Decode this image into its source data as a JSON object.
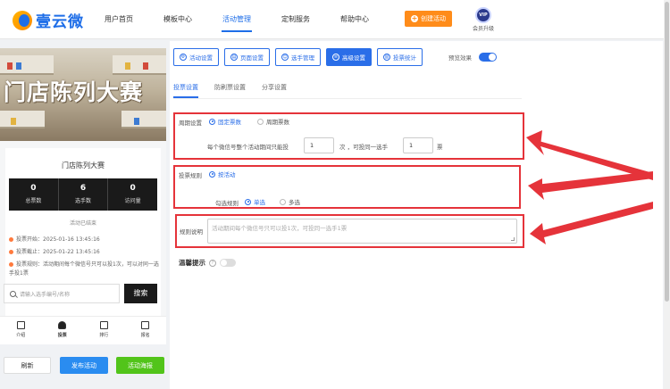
{
  "brand": {
    "name": "壹云微"
  },
  "nav": [
    {
      "label": "用户首页",
      "active": false
    },
    {
      "label": "模板中心",
      "active": false
    },
    {
      "label": "活动管理",
      "active": true
    },
    {
      "label": "定制服务",
      "active": false
    },
    {
      "label": "帮助中心",
      "active": false
    }
  ],
  "header": {
    "create_label": "创建活动",
    "vip_badge": "VIP",
    "vip_label": "会员升级"
  },
  "preview": {
    "banner_title": "门店陈列大赛",
    "contest_title": "门店陈列大赛",
    "stats": [
      {
        "value": "0",
        "label": "总票数"
      },
      {
        "value": "6",
        "label": "选手数"
      },
      {
        "value": "0",
        "label": "访问量"
      }
    ],
    "ended": "活动已结束",
    "start": "投票开始：2025-01-16 13:45:16",
    "end": "投票截止：2025-01-22 13:45:16",
    "rule": "投票规则：活动期间每个微信号只可以投1次，可以对同一选手投1票",
    "search_placeholder": "请输入选手编号/名称",
    "search_button": "搜索",
    "tabs": [
      {
        "label": "介绍",
        "active": false
      },
      {
        "label": "投票",
        "active": true
      },
      {
        "label": "排行",
        "active": false
      },
      {
        "label": "报名",
        "active": false
      }
    ]
  },
  "left_buttons": {
    "refresh": "刷新",
    "publish": "发布活动",
    "poster": "活动海报"
  },
  "toolbar": [
    {
      "label": "活动设置",
      "active": false
    },
    {
      "label": "页面设置",
      "active": false
    },
    {
      "label": "选手管理",
      "active": false
    },
    {
      "label": "高级设置",
      "active": true
    },
    {
      "label": "投票统计",
      "active": false
    }
  ],
  "preview_toggle": {
    "label": "预览效果",
    "on": true
  },
  "subtabs": [
    {
      "label": "投票设置",
      "active": true
    },
    {
      "label": "防刷票设置",
      "active": false
    },
    {
      "label": "分享设置",
      "active": false
    }
  ],
  "cycle": {
    "label": "周期设置",
    "options": [
      {
        "label": "固定票数",
        "checked": true
      },
      {
        "label": "周期票数",
        "checked": false
      }
    ],
    "prefix": "每个微信号整个活动期间只能投",
    "count": "1",
    "mid": "次 ，可投同一选手",
    "per_player": "1",
    "suffix": "票"
  },
  "vote_rule": {
    "label": "投票规则",
    "option": "按活动",
    "sub_label": "勾选规则",
    "choices": [
      {
        "label": "单选",
        "checked": true
      },
      {
        "label": "多选",
        "checked": false
      }
    ]
  },
  "rule_desc": {
    "label": "规则说明",
    "placeholder": "活动期间每个微信号只可以投1次，可投同一选手1票"
  },
  "tip": {
    "label": "温馨提示",
    "on": false
  },
  "colors": {
    "accent": "#2a6ee8",
    "highlight": "#e5333a",
    "create": "#ff8c1a"
  }
}
